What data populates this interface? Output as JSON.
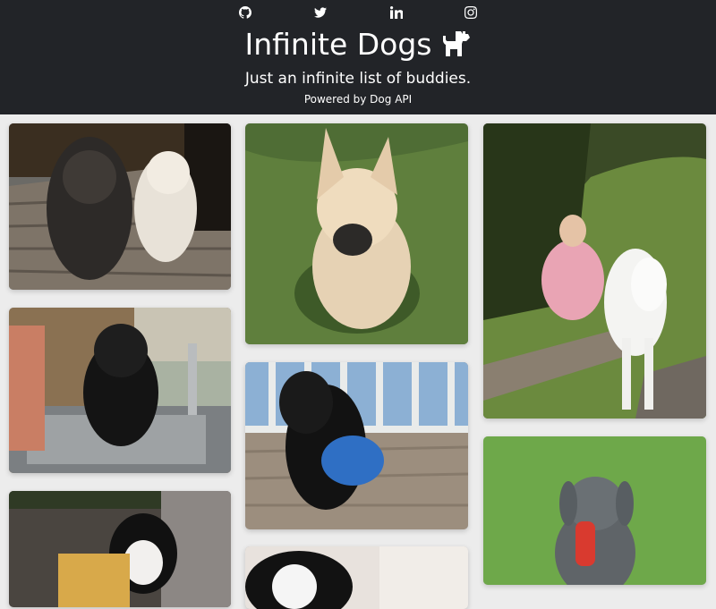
{
  "header": {
    "title": "Infinite Dogs",
    "subtitle": "Just an infinite list of buddies.",
    "powered_by": "Powered by Dog API",
    "social_icons": [
      "github-icon",
      "twitter-icon",
      "linkedin-icon",
      "instagram-icon"
    ],
    "logo_icon": "dog-icon"
  },
  "colors": {
    "header_bg": "#222428",
    "page_bg": "#ececec",
    "header_text": "#ffffff"
  },
  "gallery": {
    "columns": [
      [
        "two setters on a wooden deck",
        "black puppy being washed in a sink",
        "black and white french bulldog in a yellow shirt"
      ],
      [
        "tan puppy lying in the grass",
        "black puppy with a blue toy on a deck",
        "black and white dog"
      ],
      [
        "woman and a white dog on a bench",
        "grey weimaraner holding a red toy"
      ]
    ]
  }
}
